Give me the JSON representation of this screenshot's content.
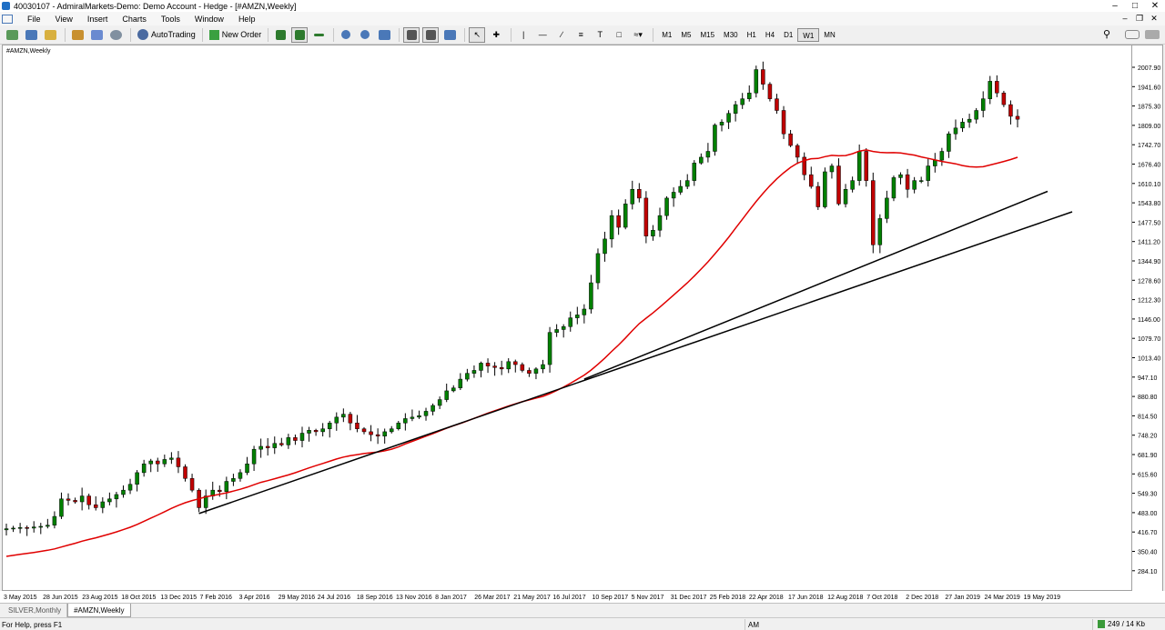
{
  "window": {
    "title": "40030107 - AdmiralMarkets-Demo: Demo Account - Hedge - [#AMZN,Weekly]"
  },
  "menu": [
    "File",
    "View",
    "Insert",
    "Charts",
    "Tools",
    "Window",
    "Help"
  ],
  "toolbar": {
    "autotrading_label": "AutoTrading",
    "new_order_label": "New Order",
    "timeframes": [
      "M1",
      "M5",
      "M15",
      "M30",
      "H1",
      "H4",
      "D1",
      "W1",
      "MN"
    ],
    "active_timeframe": "W1"
  },
  "chart_data": {
    "type": "candlestick",
    "symbol_label": "#AMZN,Weekly",
    "price_ticks": [
      "2007.90",
      "1941.60",
      "1875.30",
      "1809.00",
      "1742.70",
      "1676.40",
      "1610.10",
      "1543.80",
      "1477.50",
      "1411.20",
      "1344.90",
      "1278.60",
      "1212.30",
      "1146.00",
      "1079.70",
      "1013.40",
      "947.10",
      "880.80",
      "814.50",
      "748.20",
      "681.90",
      "615.60",
      "549.30",
      "483.00",
      "416.70",
      "350.40",
      "284.10"
    ],
    "date_ticks": [
      "3 May 2015",
      "28 Jun 2015",
      "23 Aug 2015",
      "18 Oct 2015",
      "13 Dec 2015",
      "7 Feb 2016",
      "3 Apr 2016",
      "29 May 2016",
      "24 Jul 2016",
      "18 Sep 2016",
      "13 Nov 2016",
      "8 Jan 2017",
      "26 Mar 2017",
      "21 May 2017",
      "16 Jul 2017",
      "10 Sep 2017",
      "5 Nov 2017",
      "31 Dec 2017",
      "25 Feb 2018",
      "22 Apr 2018",
      "17 Jun 2018",
      "12 Aug 2018",
      "7 Oct 2018",
      "2 Dec 2018",
      "27 Jan 2019",
      "24 Mar 2019",
      "19 May 2019"
    ],
    "close_series": [
      428,
      430,
      432,
      430,
      434,
      436,
      440,
      470,
      530,
      525,
      520,
      540,
      510,
      500,
      520,
      530,
      545,
      560,
      580,
      620,
      650,
      660,
      650,
      665,
      670,
      640,
      600,
      560,
      500,
      540,
      560,
      555,
      590,
      600,
      620,
      650,
      700,
      710,
      705,
      720,
      715,
      740,
      730,
      755,
      765,
      760,
      770,
      790,
      810,
      820,
      790,
      770,
      760,
      750,
      745,
      760,
      770,
      790,
      805,
      810,
      815,
      830,
      850,
      870,
      900,
      910,
      940,
      960,
      970,
      995,
      985,
      980,
      975,
      1000,
      990,
      970,
      960,
      975,
      990,
      1100,
      1110,
      1120,
      1150,
      1160,
      1180,
      1270,
      1370,
      1420,
      1500,
      1460,
      1540,
      1590,
      1560,
      1430,
      1450,
      1500,
      1560,
      1580,
      1600,
      1620,
      1680,
      1700,
      1720,
      1810,
      1820,
      1850,
      1880,
      1900,
      1920,
      2000,
      1950,
      1900,
      1860,
      1780,
      1740,
      1700,
      1640,
      1600,
      1530,
      1650,
      1670,
      1540,
      1590,
      1620,
      1720,
      1620,
      1400,
      1490,
      1560,
      1630,
      1640,
      1590,
      1620,
      1620,
      1670,
      1690,
      1720,
      1780,
      1800,
      1820,
      1830,
      1860,
      1900,
      1960,
      1920,
      1880,
      1840,
      1830
    ],
    "moving_average_color": "#e00000",
    "up_color": "#008000",
    "down_color": "#c00000"
  },
  "tabs": [
    "SILVER,Monthly",
    "#AMZN,Weekly"
  ],
  "active_tab": "#AMZN,Weekly",
  "status": {
    "help": "For Help, press F1",
    "session": "AM",
    "traffic": "249 / 14 Kb"
  }
}
